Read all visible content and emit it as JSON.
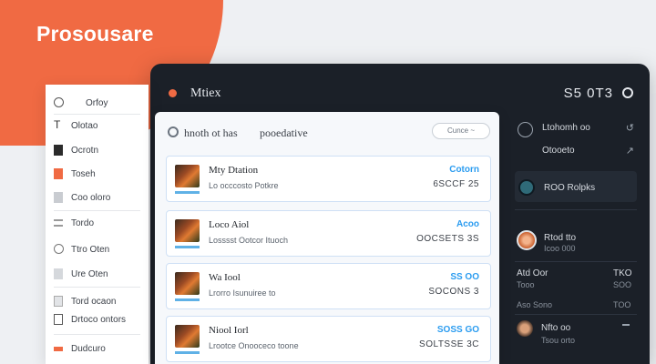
{
  "brand": "Prosousare",
  "colors": {
    "accent": "#f06a43",
    "link": "#2b9cf0",
    "dark": "#1b2028"
  },
  "window": {
    "title": "Mtiex",
    "right_text": "S5 0T3"
  },
  "sidebar": {
    "items": [
      {
        "icon": "smile-icon",
        "label": "Orfoy"
      },
      {
        "icon": "text-icon",
        "label": "Olotao"
      },
      {
        "icon": "document-icon",
        "label": "Ocrotn"
      },
      {
        "icon": "orange-square-icon",
        "label": "Toseh"
      },
      {
        "icon": "grid-icon",
        "label": "Coo oloro"
      },
      {
        "icon": "list-icon",
        "label": "Tordo"
      },
      {
        "icon": "gauge-icon",
        "label": "Ttro Oten"
      },
      {
        "icon": "layers-icon",
        "label": "Ure Oten"
      },
      {
        "icon": "folder-icon",
        "label": "Tord ocaon"
      },
      {
        "icon": "monitor-icon",
        "label": "Drtoco ontors"
      },
      {
        "icon": "orange-bar-icon",
        "label": "Dudcuro"
      }
    ]
  },
  "main": {
    "title": "hnoth ot has",
    "subtitle": "pooedative",
    "filter_label": "Cunce ~",
    "rows": [
      {
        "name": "Mty Dtation",
        "detail": "Lo occcosto Potkre",
        "tag": "Cotorn",
        "amount": "6SCCF 25"
      },
      {
        "name": "Loco Aiol",
        "detail": "Losssst Ootcor Ituoch",
        "tag": "Acoo",
        "amount": "OOCSETS 3S"
      },
      {
        "name": "Wa Iool",
        "detail": "Lrorro Isunuiree to",
        "tag": "SS OO",
        "amount": "SOCONS 3"
      },
      {
        "name": "Niool Iorl",
        "detail": "Lrootce Onooceco toone",
        "tag": "SOSS GO",
        "amount": "SOLTSSE 3C"
      }
    ]
  },
  "right_panel": {
    "items": [
      {
        "label": "Ltohomh oo",
        "mark": "↺"
      },
      {
        "label": "Otooeto",
        "mark": "↗"
      }
    ],
    "highlight": "ROO Rolpks",
    "contact": {
      "name": "Rtod tto",
      "detail": "Icoo 000"
    },
    "stats": [
      {
        "label": "Atd Oor",
        "value": "TKO"
      },
      {
        "label": "Tooo",
        "value": "SOO"
      },
      {
        "label": "Aso Sono",
        "value": "TOO"
      }
    ],
    "user": {
      "name": "Nfto oo",
      "detail": "Tsou orto"
    }
  }
}
